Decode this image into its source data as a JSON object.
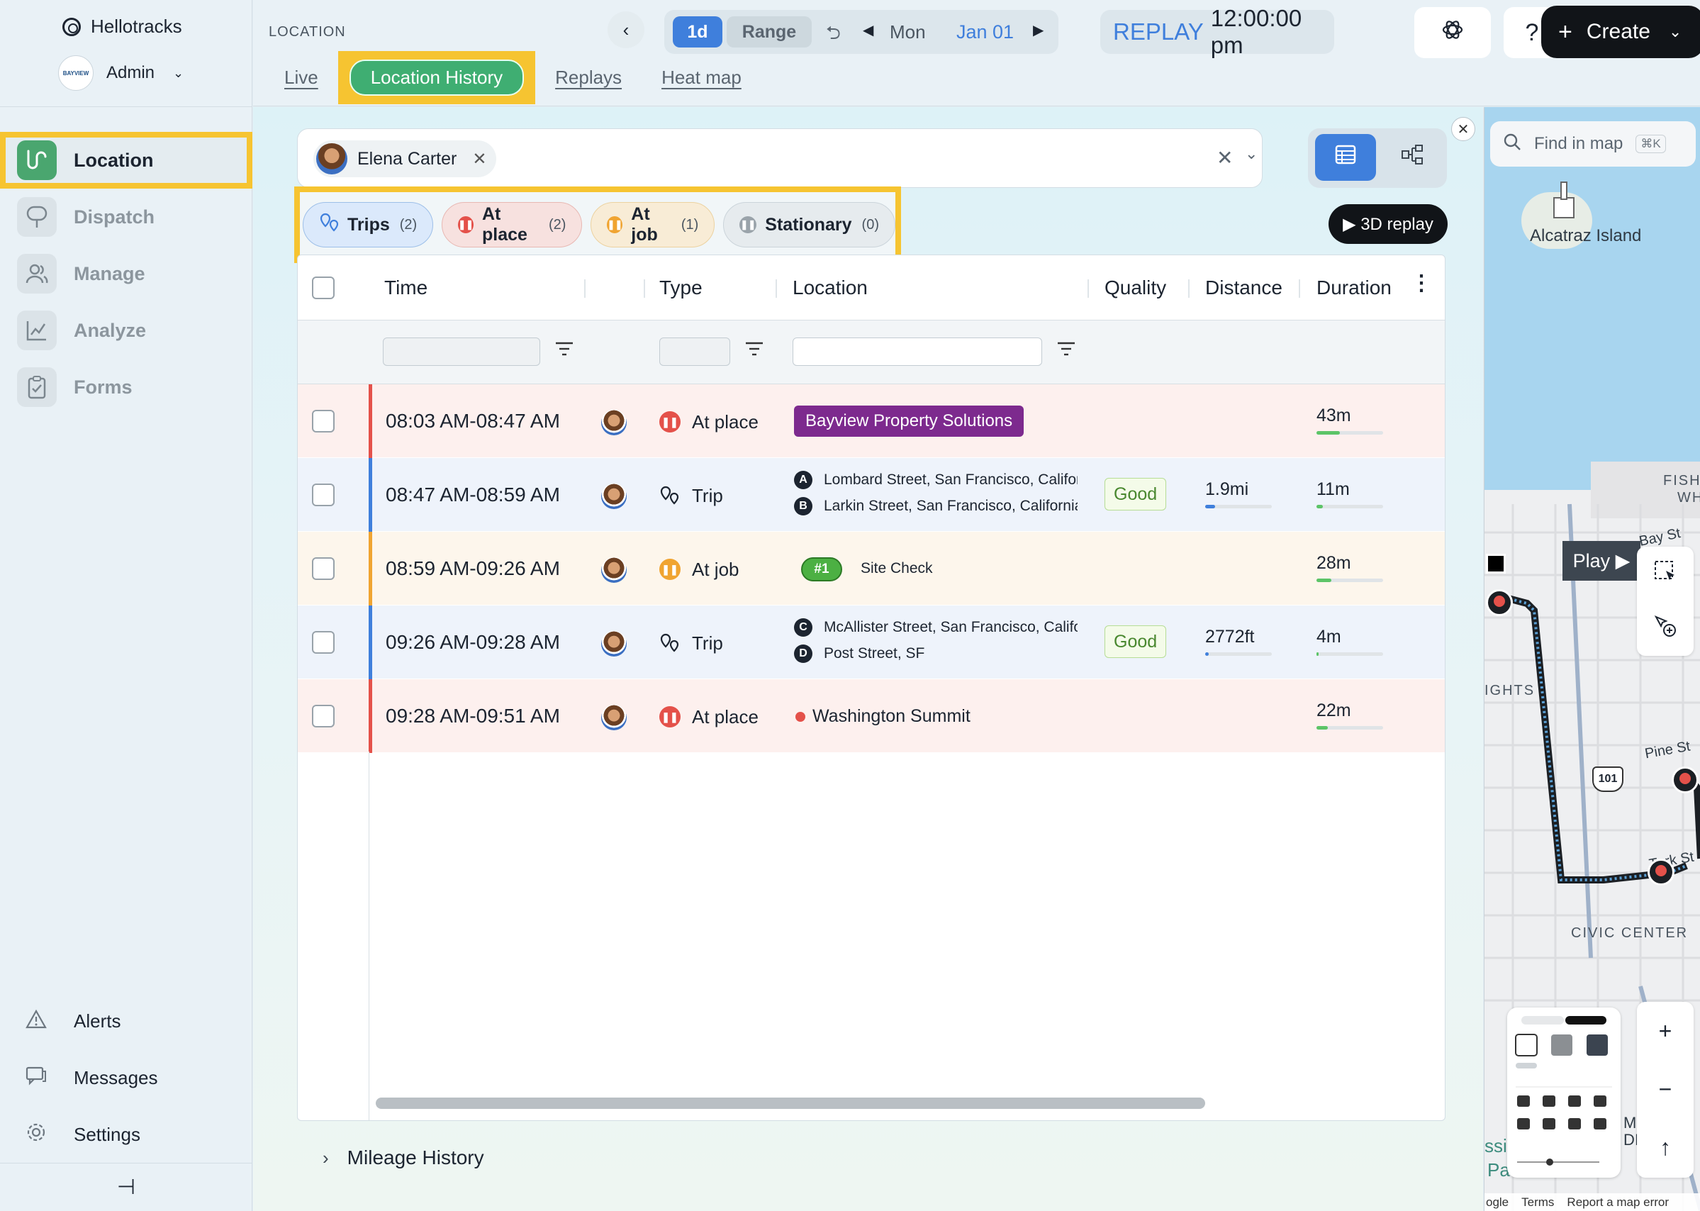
{
  "sidebar": {
    "brand": "Hellotracks",
    "account_badge": "BAYVIEW",
    "account": "Admin",
    "nav": [
      {
        "label": "Location",
        "icon": "route-icon",
        "active": true
      },
      {
        "label": "Dispatch",
        "icon": "dispatch-icon",
        "active": false
      },
      {
        "label": "Manage",
        "icon": "users-icon",
        "active": false
      },
      {
        "label": "Analyze",
        "icon": "chart-icon",
        "active": false
      },
      {
        "label": "Forms",
        "icon": "clipboard-icon",
        "active": false
      }
    ],
    "bottom": [
      {
        "label": "Alerts",
        "icon": "warning-icon"
      },
      {
        "label": "Messages",
        "icon": "messages-icon"
      },
      {
        "label": "Settings",
        "icon": "gear-icon"
      }
    ],
    "pin_glyph": "⊣"
  },
  "header": {
    "section": "LOCATION",
    "tabs": [
      {
        "label": "Live",
        "active": false
      },
      {
        "label": "Location History",
        "active": true
      },
      {
        "label": "Replays",
        "active": false
      },
      {
        "label": "Heat map",
        "active": false
      }
    ],
    "date": {
      "mode_1d": "1d",
      "mode_range": "Range",
      "day": "Mon",
      "date": "Jan 01"
    },
    "replay_label": "REPLAY",
    "replay_time": "12:00:00 pm",
    "help": "?",
    "create": "Create"
  },
  "filter": {
    "user": "Elena Carter",
    "pills": [
      {
        "key": "trips",
        "label": "Trips",
        "count": "(2)"
      },
      {
        "key": "atplace",
        "label": "At place",
        "count": "(2)"
      },
      {
        "key": "atjob",
        "label": "At job",
        "count": "(1)"
      },
      {
        "key": "stationary",
        "label": "Stationary",
        "count": "(0)"
      }
    ],
    "replay3d": "▶ 3D replay"
  },
  "table": {
    "columns": {
      "time": "Time",
      "type": "Type",
      "location": "Location",
      "quality": "Quality",
      "distance": "Distance",
      "duration": "Duration"
    },
    "rows": [
      {
        "time": "08:03 AM-08:47 AM",
        "type": "At place",
        "kind": "place",
        "location": "Bayview Property Solutions",
        "duration": "43m",
        "duration_fraction": 0.35
      },
      {
        "time": "08:47 AM-08:59 AM",
        "type": "Trip",
        "kind": "trip",
        "from_letter": "A",
        "from": "Lombard Street, San Francisco, California",
        "to_letter": "B",
        "to": "Larkin Street, San Francisco, California",
        "quality": "Good",
        "distance": "1.9mi",
        "distance_fraction": 0.15,
        "duration": "11m",
        "duration_fraction": 0.1
      },
      {
        "time": "08:59 AM-09:26 AM",
        "type": "At job",
        "kind": "job",
        "job_number": "#1",
        "job_name": "Site Check",
        "duration": "28m",
        "duration_fraction": 0.22
      },
      {
        "time": "09:26 AM-09:28 AM",
        "type": "Trip",
        "kind": "trip",
        "from_letter": "C",
        "from": "McAllister Street, San Francisco, California",
        "to_letter": "D",
        "to": "Post Street, SF",
        "quality": "Good",
        "distance": "2772ft",
        "distance_fraction": 0.05,
        "duration": "4m",
        "duration_fraction": 0.03
      },
      {
        "time": "09:28 AM-09:51 AM",
        "type": "At place",
        "kind": "place-plain",
        "location": "Washington Summit",
        "duration": "22m",
        "duration_fraction": 0.17
      }
    ]
  },
  "mileage": "Mileage History",
  "map": {
    "search_placeholder": "Find in map",
    "search_shortcut": "⌘K",
    "labels": {
      "alcatraz": "Alcatraz Island",
      "fisherman": "FISHE",
      "wharf": "WH",
      "bay": "Bay St",
      "heights": "IGHTS",
      "pine": "Pine St",
      "turk": "Turk St",
      "civic": "CIVIC CENTER",
      "highway": "101",
      "mission_a": "ssi",
      "mission_b": "Pa",
      "edge_m": "M",
      "edge_di": "DI"
    },
    "play": "Play ▶",
    "zoom_in": "+",
    "zoom_out": "−",
    "compass": "↑",
    "attribution": [
      "ogle",
      "Terms",
      "Report a map error"
    ]
  },
  "colors": {
    "accent": "#3f7fdc",
    "active_green": "#3fae72",
    "highlight": "#f6c431",
    "at_place": "#e4514a",
    "at_job": "#f0a431",
    "trip": "#3f7fdc",
    "stationary": "#9aa3aa",
    "place_badge": "#7d2a8e"
  }
}
